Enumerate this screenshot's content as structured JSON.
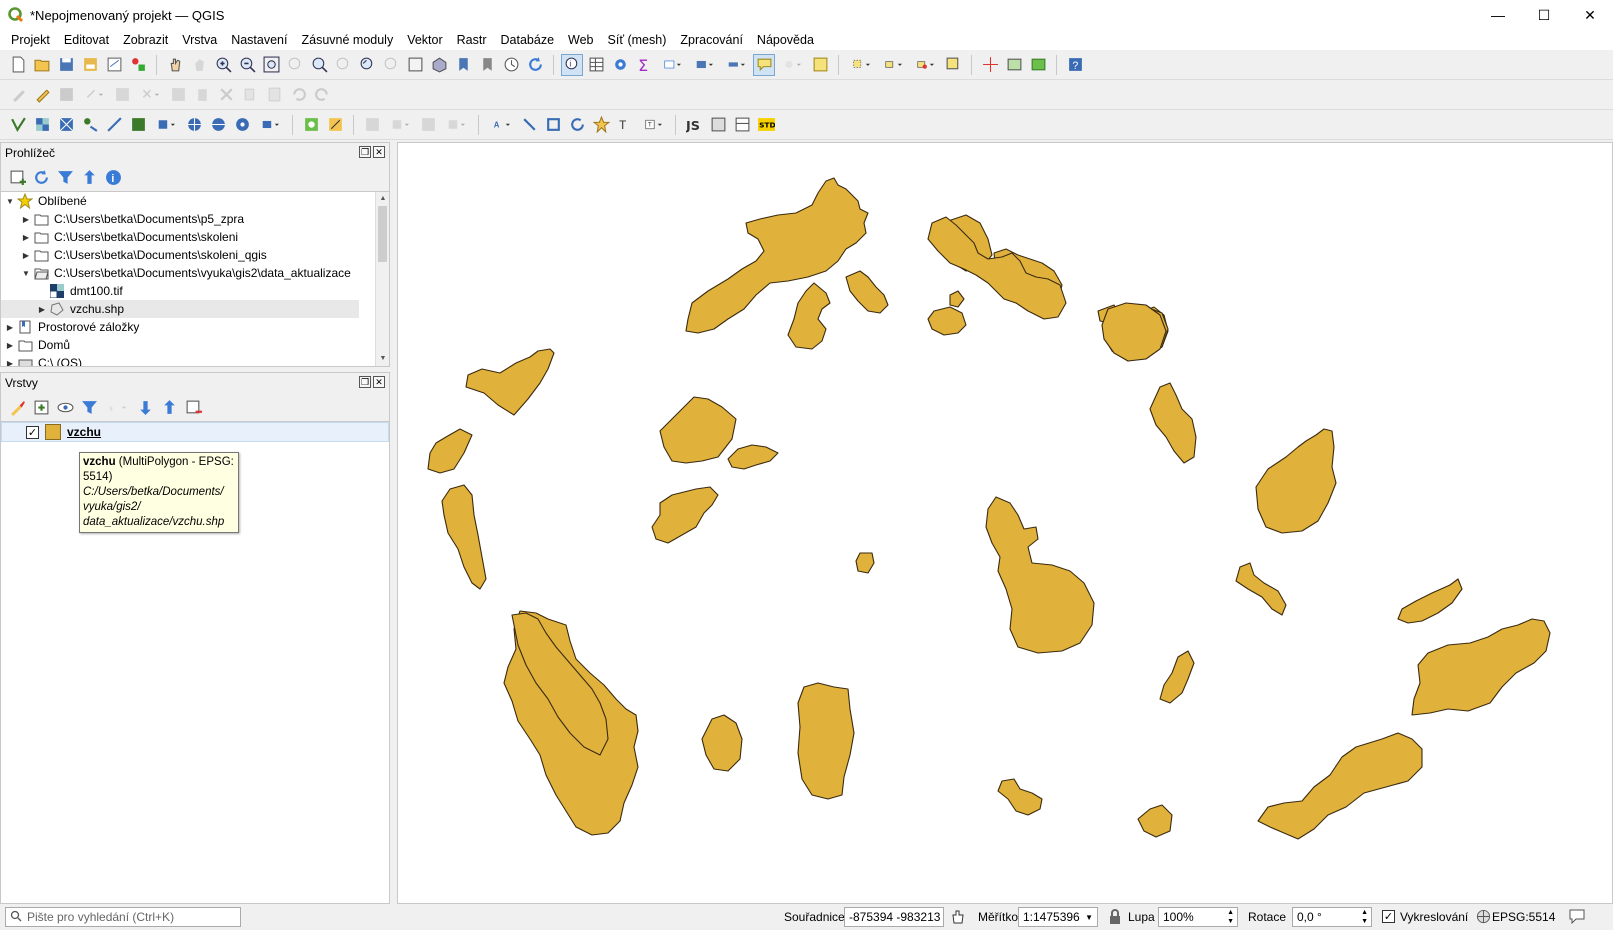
{
  "window": {
    "title": "*Nepojmenovaný projekt — QGIS",
    "controls": [
      "—",
      "☐",
      "✕"
    ]
  },
  "menu": [
    "Projekt",
    "Editovat",
    "Zobrazit",
    "Vrstva",
    "Nastavení",
    "Zásuvné moduly",
    "Vektor",
    "Rastr",
    "Databáze",
    "Web",
    "Síť (mesh)",
    "Zpracování",
    "Nápověda"
  ],
  "browser": {
    "title": "Prohlížeč",
    "items": [
      {
        "label": "Oblíbené",
        "expanded": true,
        "icon": "star-icon"
      },
      {
        "label": "C:\\Users\\betka\\Documents\\p5_zpra",
        "icon": "folder-icon"
      },
      {
        "label": "C:\\Users\\betka\\Documents\\skoleni",
        "icon": "folder-icon"
      },
      {
        "label": "C:\\Users\\betka\\Documents\\skoleni_qgis",
        "icon": "folder-icon"
      },
      {
        "label": "C:\\Users\\betka\\Documents\\vyuka\\gis2\\data_aktualizace",
        "icon": "folder-open-icon"
      },
      {
        "label": "dmt100.tif",
        "icon": "raster-icon"
      },
      {
        "label": "vzchu.shp",
        "icon": "polygon-layer-icon"
      },
      {
        "label": "Prostorové záložky",
        "icon": "bookmark-icon"
      },
      {
        "label": "Domů",
        "icon": "folder-icon"
      },
      {
        "label": "C:\\ (OS)",
        "icon": "drive-icon"
      }
    ]
  },
  "layers": {
    "title": "Vrstvy",
    "items": [
      {
        "name": "vzchu",
        "checked": true,
        "color": "#e1b23b"
      }
    ]
  },
  "tooltip": {
    "name": "vzchu",
    "type": " (MultiPolygon - EPSG: 5514)",
    "path": "C:/Users/betka/Documents/ vyuka/gis2/ data_aktualizace/vzchu.shp"
  },
  "statusbar": {
    "search_placeholder": "Pište pro vyhledání (Ctrl+K)",
    "coord_label": "Souřadnice",
    "coord_value": "-875394 -983213",
    "scale_label": "Měřítko",
    "scale_value": "1:1475396",
    "magnifier_label": "Lupa",
    "magnifier_value": "100%",
    "rotation_label": "Rotace",
    "rotation_value": "0,0 °",
    "render_label": "Vykreslování",
    "crs": "EPSG:5514"
  },
  "colors": {
    "polygon_fill": "#e1b23b",
    "polygon_stroke": "#3a2a10",
    "accent": "#3b7ea1"
  }
}
